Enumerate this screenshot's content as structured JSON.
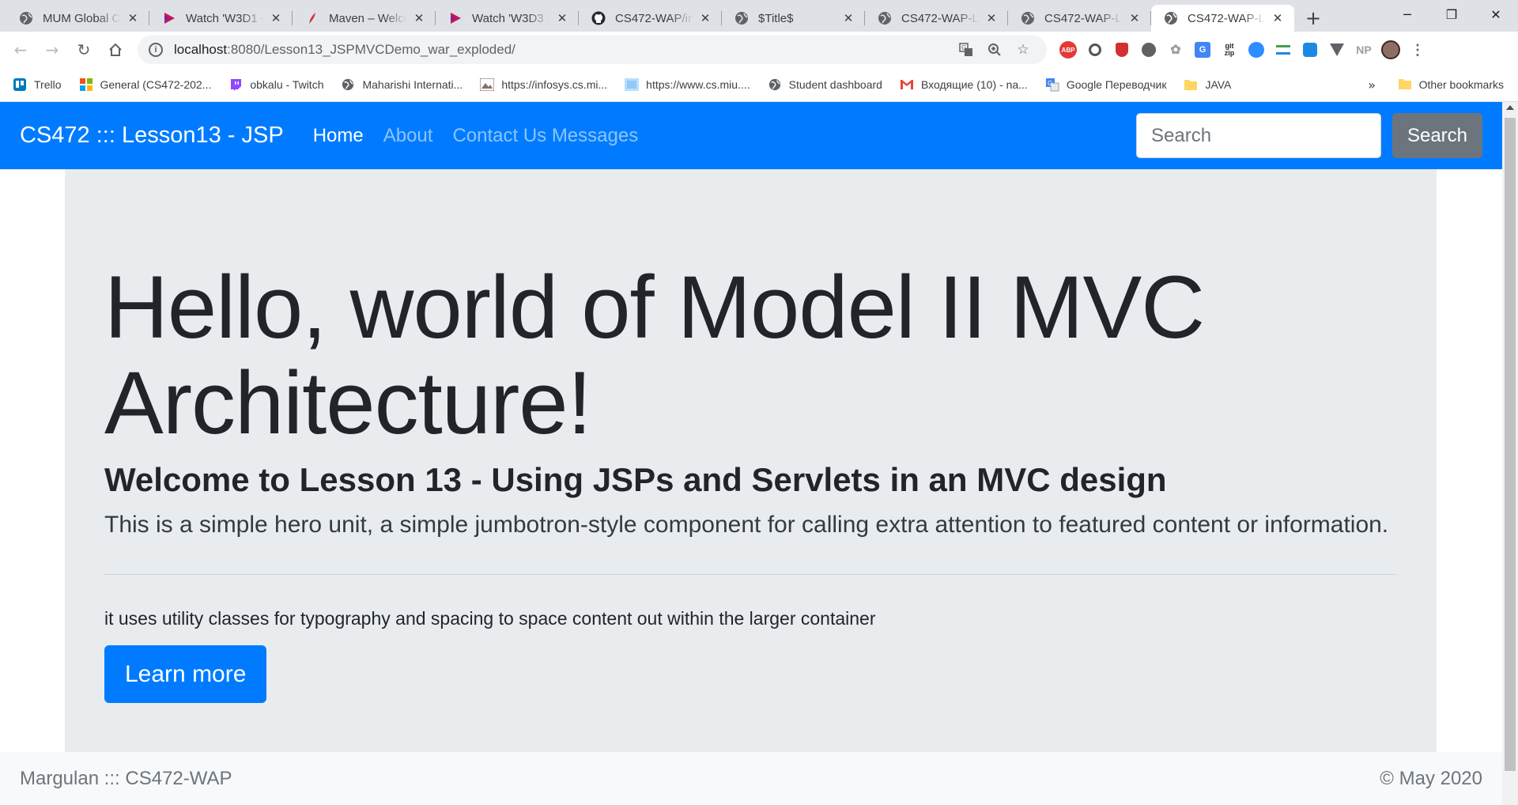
{
  "browser": {
    "tabs": [
      {
        "title": "MUM Global O",
        "icon": "globe"
      },
      {
        "title": "Watch 'W3D1 -",
        "icon": "play"
      },
      {
        "title": "Maven – Welco",
        "icon": "feather"
      },
      {
        "title": "Watch 'W3D3 -",
        "icon": "play"
      },
      {
        "title": "CS472-WAP/inc",
        "icon": "github"
      },
      {
        "title": "$Title$",
        "icon": "globe"
      },
      {
        "title": "CS472-WAP-Le",
        "icon": "globe"
      },
      {
        "title": "CS472-WAP-Le",
        "icon": "globe"
      },
      {
        "title": "CS472-WAP-Le",
        "icon": "globe",
        "active": true
      }
    ],
    "url_host": "localhost",
    "url_rest": ":8080/Lesson13_JSPMVCDemo_war_exploded/",
    "bookmarks": [
      {
        "label": "Trello",
        "icon": "trello"
      },
      {
        "label": "General (CS472-202...",
        "icon": "microsoft"
      },
      {
        "label": "obkalu - Twitch",
        "icon": "twitch"
      },
      {
        "label": "Maharishi Internati...",
        "icon": "globe"
      },
      {
        "label": "https://infosys.cs.mi...",
        "icon": "image"
      },
      {
        "label": "https://www.cs.miu....",
        "icon": "image"
      },
      {
        "label": "Student dashboard",
        "icon": "globe"
      },
      {
        "label": "Входящие (10) - na...",
        "icon": "gmail"
      },
      {
        "label": "Google Переводчик",
        "icon": "translate"
      },
      {
        "label": "JAVA",
        "icon": "folder"
      }
    ],
    "other_bookmarks": "Other bookmarks",
    "extensions": [
      "ABP",
      "NP"
    ]
  },
  "navbar": {
    "brand": "CS472 ::: Lesson13 - JSP",
    "links": [
      "Home",
      "About",
      "Contact Us Messages"
    ],
    "search_placeholder": "Search",
    "search_button": "Search"
  },
  "jumbotron": {
    "heading_line1": "Hello, world of Model II MVC",
    "heading_line2": "Architecture!",
    "subheading": "Welcome to Lesson 13 - Using JSPs and Servlets in an MVC design",
    "lead": "This is a simple hero unit, a simple jumbotron-style component for calling extra attention to featured content or information.",
    "body": "it uses utility classes for typography and spacing to space content out within the larger container",
    "button": "Learn more"
  },
  "footer": {
    "left": "Margulan ::: CS472-WAP",
    "right": "© May 2020"
  },
  "colors": {
    "primary": "#007bff",
    "jumbotron_bg": "#e9ecef",
    "secondary": "#6c757d"
  }
}
